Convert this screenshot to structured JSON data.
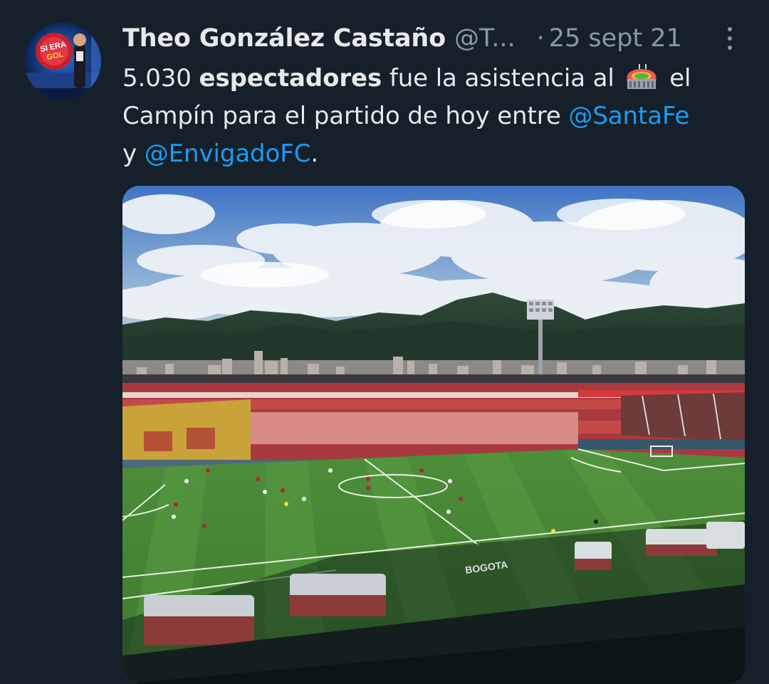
{
  "tweet": {
    "author": {
      "display_name": "Theo González Castaño",
      "handle": "@T...",
      "avatar_text": "SI ERA GOL"
    },
    "date_separator": "·",
    "date": "25 sept 21",
    "text": {
      "line1_a": "5.030 ",
      "line1_bold": "espectadores",
      "line1_b": " fue la asistencia al ",
      "line1_c": " el",
      "line2_a": "Campín para el partido de hoy entre ",
      "mention1": "@SantaFe",
      "line3_a": "y ",
      "mention2": "@EnvigadoFC",
      "line3_b": "."
    },
    "media": {
      "banner_text": "BOGOTA"
    }
  },
  "colors": {
    "background": "#15202b",
    "primary_text": "#e7e9ea",
    "secondary_text": "#8b98a5",
    "link": "#1d9bf0"
  },
  "icons": {
    "more": "more-vertical-icon",
    "emoji": "stadium-emoji-icon"
  }
}
